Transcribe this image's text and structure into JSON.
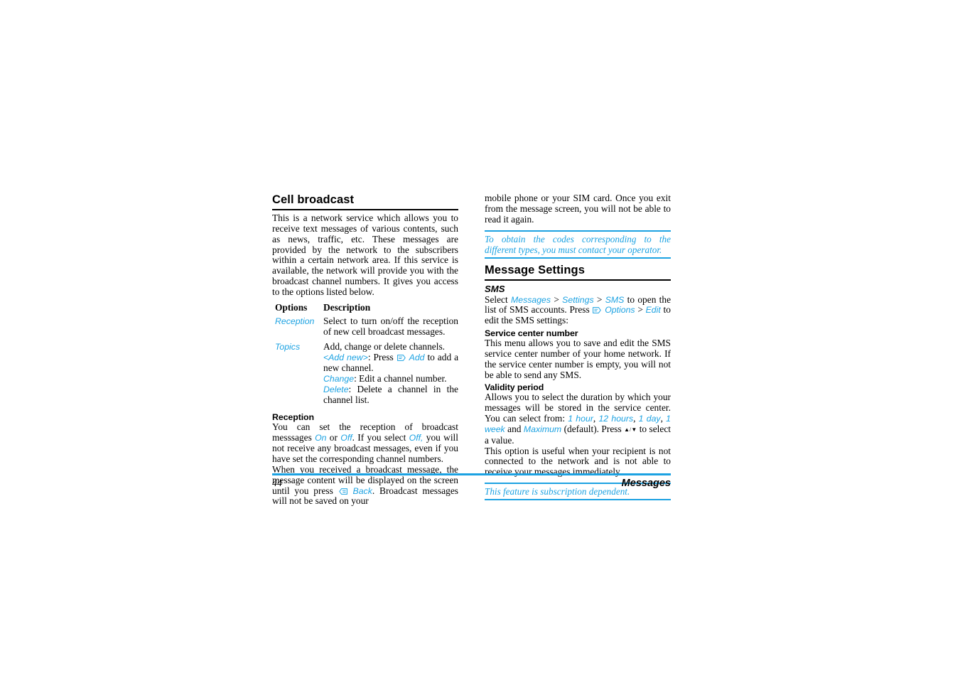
{
  "page": {
    "number": "44",
    "chapter": "Messages"
  },
  "left_column": {
    "heading": "Cell broadcast",
    "intro": "This is a network service which allows you to receive text messages of various contents, such as news, traffic, etc. These messages are provided by the network to the subscribers within a certain network area. If this service is available, the network will provide you with the broadcast channel numbers. It gives you access to the options listed below.",
    "table": {
      "headers": [
        "Options",
        "Description"
      ],
      "rows": [
        {
          "option": "Reception",
          "description": "Select to turn on/off the reception of new cell broadcast messages."
        },
        {
          "option": "Topics",
          "desc_line1": "Add, change or delete channels.",
          "desc_addnew_label": "<Add new>",
          "desc_addnew_press": ": Press",
          "desc_addnew_icon": "softkey-left-icon",
          "desc_addnew_action": "Add",
          "desc_addnew_tail": "to add a new channel.",
          "desc_change_label": "Change",
          "desc_change_text": ": Edit a channel number.",
          "desc_delete_label": "Delete",
          "desc_delete_text": ": Delete a channel in the channel list."
        }
      ]
    },
    "reception": {
      "heading": "Reception",
      "para1_a": "You can set the reception of broadcast messsages",
      "para1_on": "On",
      "para1_b": "or",
      "para1_off1": "Off",
      "para1_c": ". If you select",
      "para1_off2": "Off,",
      "para1_d": "you will not receive any broadcast messages, even if you have set the corresponding channel numbers.",
      "para2_a": "When you received a broadcast message, the message content will be displayed on the screen until you press",
      "para2_icon": "softkey-right-icon",
      "para2_back": "Back",
      "para2_b": ". Broadcast messages will not be saved on your"
    }
  },
  "right_column": {
    "continued_text": "mobile phone or your SIM card. Once you exit from the message screen, you will not be able to read it again.",
    "note_top": "To obtain the codes corresponding to the different types, you must contact your operator.",
    "heading": "Message Settings",
    "sms": {
      "heading": "SMS",
      "select_label": "Select",
      "path": [
        "Messages",
        "Settings",
        "SMS"
      ],
      "separator": ">",
      "after_path": "to open the list of SMS accounts. Press",
      "options_icon": "softkey-left-icon",
      "options_label": "Options",
      "edit_label": "Edit",
      "tail": "to edit the SMS settings:"
    },
    "service_center": {
      "heading": "Service center number",
      "body": "This menu allows you to save and edit the SMS service center number of your home network. If the service center number is empty, you will not be able to send any SMS."
    },
    "validity": {
      "heading": "Validity period",
      "body_a": "Allows you to select the duration by which your messages will be stored in the service center. You can select from:",
      "values": [
        "1 hour",
        "12 hours",
        "1 day",
        "1 week"
      ],
      "and_label": "and",
      "default_value": "Maximum",
      "body_b": "(default). Press",
      "arrows": "▲/▼",
      "body_c": "to select a value.",
      "body_d": "This option is useful when your recipient is not connected to the network and is not able to receive your messages immediately."
    },
    "note_bottom": "This feature is subscription dependent."
  },
  "colors": {
    "accent_cyan": "#1CA2E2",
    "text_black": "#000000",
    "page_background": "#FFFFFF"
  }
}
